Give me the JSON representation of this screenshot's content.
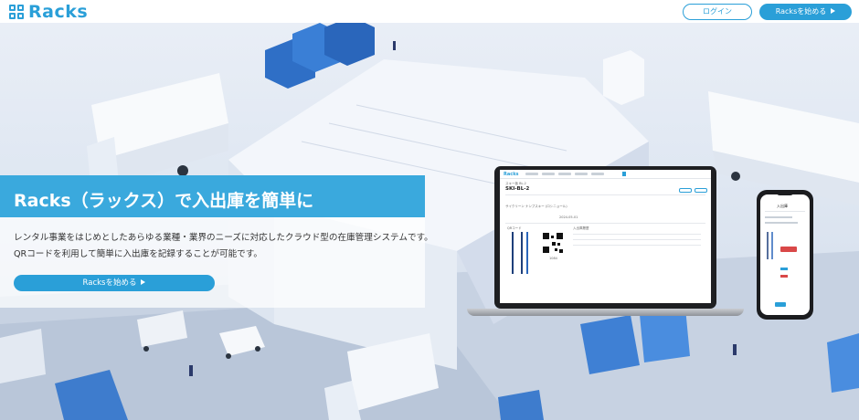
{
  "header": {
    "logo_text": "Racks",
    "login_label": "ログイン",
    "start_label": "Racksを始める"
  },
  "hero": {
    "title": "Racks（ラックス）で入出庫を簡単に",
    "desc_line1": "レンタル事業をはじめとしたあらゆる業種・業界のニーズに対応したクラウド型の在庫管理システムです。",
    "desc_line2": "QRコードを利用して簡単に入出庫を記録することが可能です。",
    "cta_label": "Racksを始める"
  },
  "laptop": {
    "app_logo": "Racks",
    "item_code": "SKI-BL-2",
    "item_name": "スキー板 BL-2",
    "product_name": "サイクリーン ナンブスキー (ロシニョール)",
    "date": "2024-05-01",
    "qr_label": "QRコード",
    "history_label": "入出庫履歴",
    "qr_caption": "1084"
  },
  "phone": {
    "title": "入出庫"
  },
  "colors": {
    "brand": "#2a9fd8",
    "hero_bar": "#3aa9dd"
  }
}
